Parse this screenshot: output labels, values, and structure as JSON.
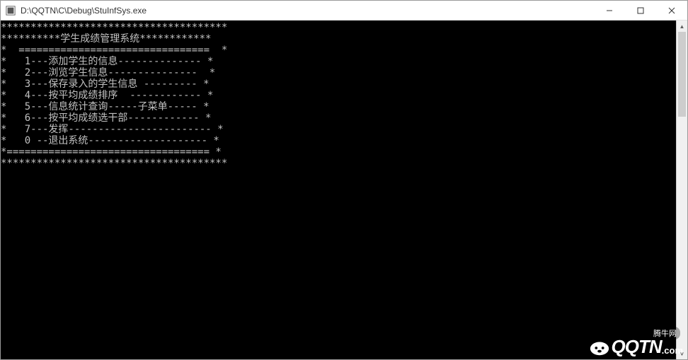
{
  "window": {
    "title": "D:\\QQTN\\C\\Debug\\StuInfSys.exe"
  },
  "console": {
    "lines": [
      "**************************************",
      "**********学生成绩管理系统************",
      "*  ================================  *",
      "*   1---添加学生的信息-------------- *",
      "*   2---浏览学生信息---------------  *",
      "*   3---保存录入的学生信息 --------- *",
      "*   4---按平均成绩排序  ------------ *",
      "*   5---信息统计查询-----子菜单----- *",
      "*   6---按平均成绩选干部------------ *",
      "*   7---发挥------------------------ *",
      "*   0 --退出系统-------------------- *",
      "*================================== *",
      "**************************************"
    ]
  },
  "watermark": {
    "brand": "QQTN",
    "suffix": ".com",
    "cn_label": "腾牛网"
  }
}
